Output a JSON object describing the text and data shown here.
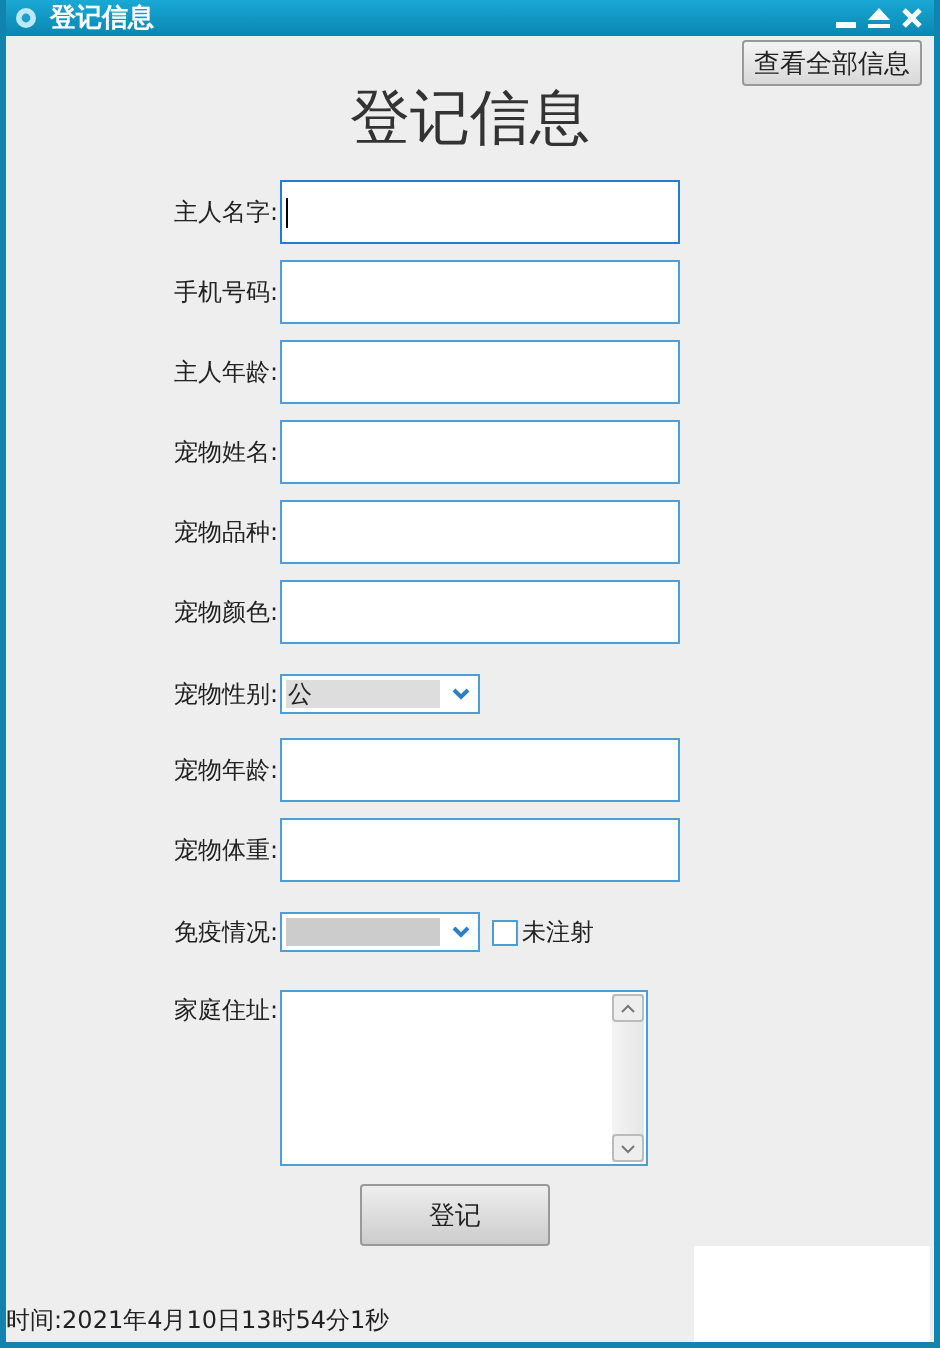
{
  "window": {
    "title": "登记信息"
  },
  "view_all_button": "查看全部信息",
  "heading": "登记信息",
  "fields": [
    {
      "kind": "text",
      "label": "主人名字:",
      "focused": true
    },
    {
      "kind": "text",
      "label": "手机号码:",
      "focused": false
    },
    {
      "kind": "text",
      "label": "主人年龄:",
      "focused": false
    },
    {
      "kind": "text",
      "label": "宠物姓名:",
      "focused": false
    },
    {
      "kind": "text",
      "label": "宠物品种:",
      "focused": false
    },
    {
      "kind": "text",
      "label": "宠物颜色:",
      "focused": false
    },
    {
      "kind": "select",
      "label": "宠物性别:",
      "value": "公"
    },
    {
      "kind": "text",
      "label": "宠物年龄:",
      "focused": false
    },
    {
      "kind": "text",
      "label": "宠物体重:",
      "focused": false
    },
    {
      "kind": "select",
      "label": "免疫情况:",
      "checkbox": {
        "label": "未注射",
        "checked": false
      }
    },
    {
      "kind": "textarea",
      "label": "家庭住址:"
    }
  ],
  "submit_button": "登记",
  "status": "时间:2021年4月10日13时54分1秒"
}
